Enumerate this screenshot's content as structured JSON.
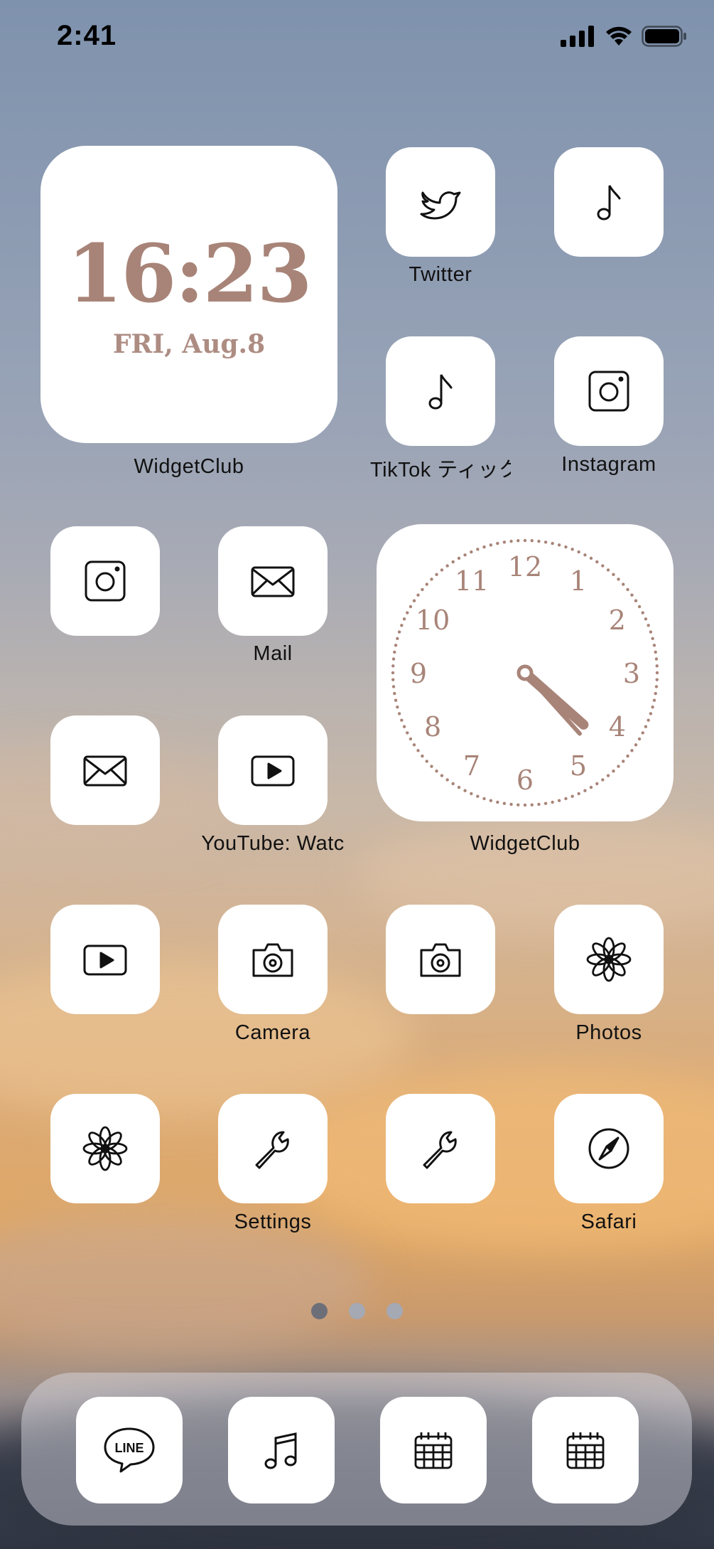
{
  "status_bar": {
    "time": "2:41",
    "icons": [
      "cellular-signal-icon",
      "wifi-icon",
      "battery-icon"
    ]
  },
  "clock_widget": {
    "time": "16:23",
    "date": "FRI, Aug.8",
    "label": "WidgetClub",
    "text_color": "#a88478"
  },
  "analog_clock_widget": {
    "label": "WidgetClub",
    "numerals": [
      "12",
      "1",
      "2",
      "3",
      "4",
      "5",
      "6",
      "7",
      "8",
      "9",
      "10",
      "11"
    ],
    "hour": 4,
    "minute": 23,
    "hand_color": "#a88478"
  },
  "apps": [
    {
      "label": "Twitter",
      "icon": "bird-icon"
    },
    {
      "label": "",
      "icon": "music-note-icon"
    },
    {
      "label": "TikTok ティック",
      "icon": "music-note-icon"
    },
    {
      "label": "Instagram",
      "icon": "camera-square-icon"
    },
    {
      "label": "",
      "icon": "camera-square-icon"
    },
    {
      "label": "Mail",
      "icon": "envelope-icon"
    },
    {
      "label": "",
      "icon": "envelope-icon"
    },
    {
      "label": "YouTube: Watc",
      "icon": "play-button-icon"
    },
    {
      "label": "",
      "icon": "play-button-icon"
    },
    {
      "label": "Camera",
      "icon": "camera-icon"
    },
    {
      "label": "",
      "icon": "camera-icon"
    },
    {
      "label": "Photos",
      "icon": "flower-icon"
    },
    {
      "label": "",
      "icon": "flower-icon"
    },
    {
      "label": "Settings",
      "icon": "wrench-icon"
    },
    {
      "label": "",
      "icon": "wrench-icon"
    },
    {
      "label": "Safari",
      "icon": "compass-icon"
    }
  ],
  "page_indicator": {
    "pages": 3,
    "current": 1
  },
  "dock": [
    {
      "text": "LINE",
      "icon": "line-speech-bubble-icon"
    },
    {
      "icon": "music-notes-icon"
    },
    {
      "icon": "calendar-icon"
    },
    {
      "icon": "calendar-icon"
    }
  ]
}
